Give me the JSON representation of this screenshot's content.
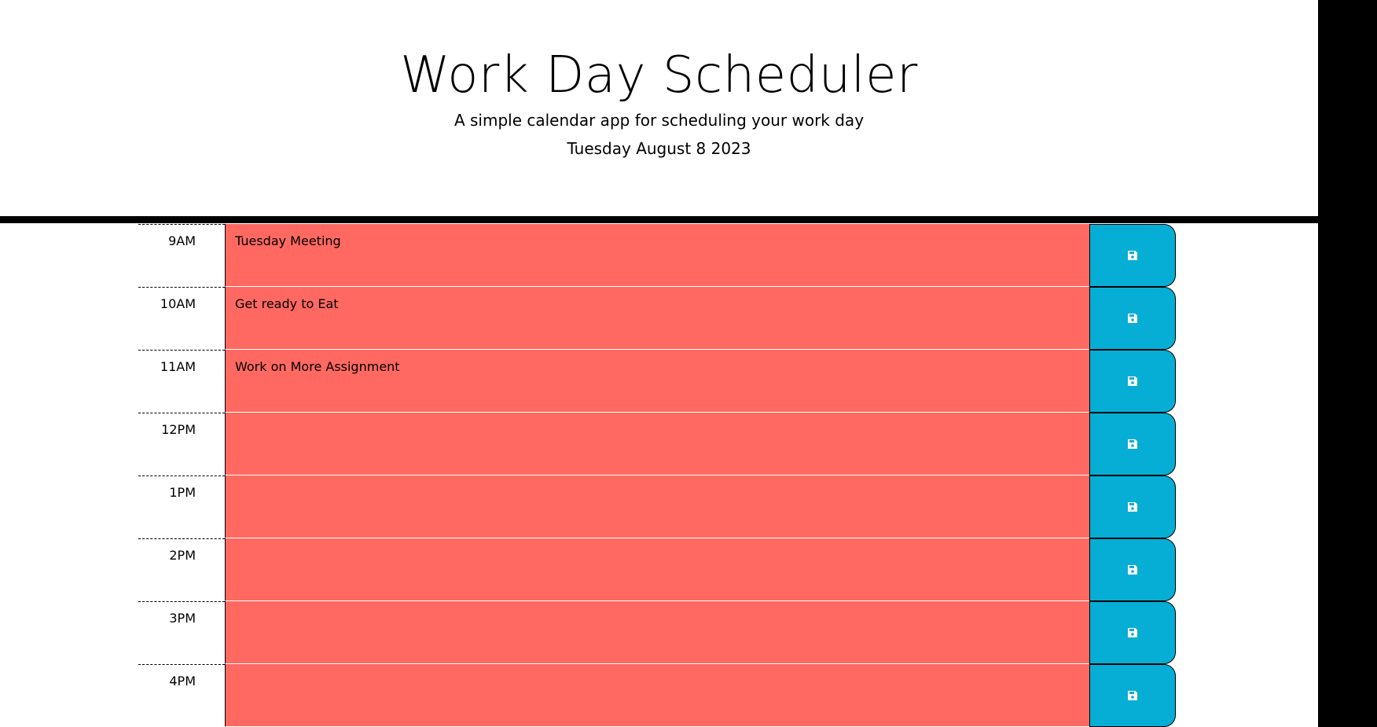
{
  "header": {
    "title": "Work Day Scheduler",
    "subtitle": "A simple calendar app for scheduling your work day",
    "current_day": "Tuesday August 8 2023"
  },
  "colors": {
    "past_block": "#ff6961",
    "save_button": "#06aed5"
  },
  "save_button_icon": "save-icon",
  "time_blocks": [
    {
      "hour": "9AM",
      "text": "Tuesday Meeting"
    },
    {
      "hour": "10AM",
      "text": "Get ready to Eat"
    },
    {
      "hour": "11AM",
      "text": "Work on More Assignment"
    },
    {
      "hour": "12PM",
      "text": ""
    },
    {
      "hour": "1PM",
      "text": ""
    },
    {
      "hour": "2PM",
      "text": ""
    },
    {
      "hour": "3PM",
      "text": ""
    },
    {
      "hour": "4PM",
      "text": ""
    }
  ]
}
